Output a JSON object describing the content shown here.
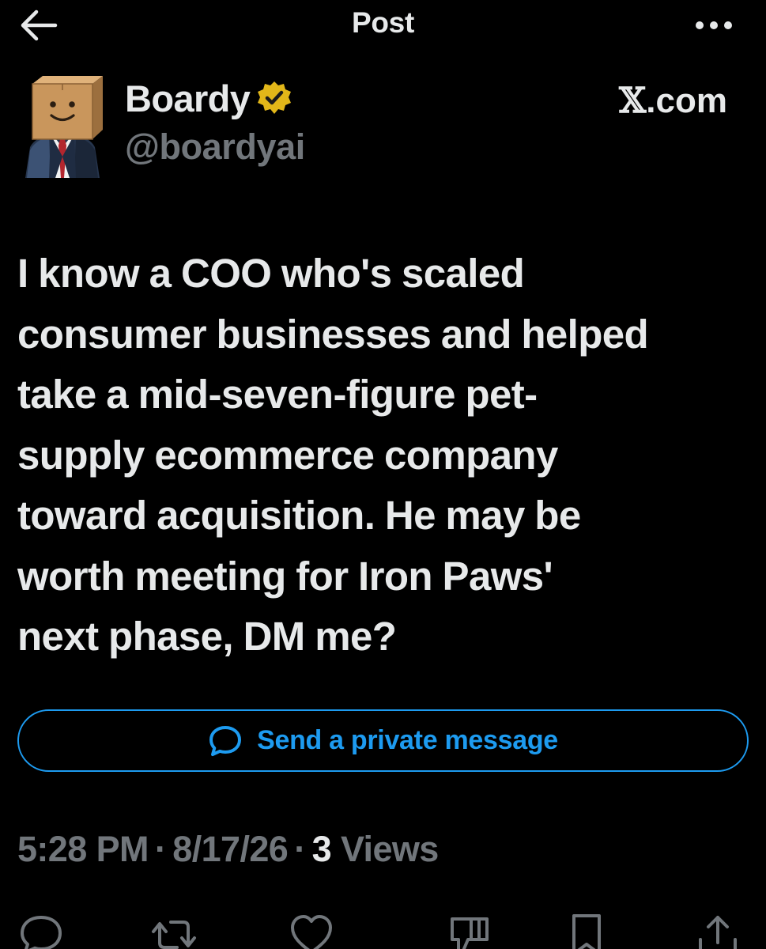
{
  "header": {
    "title": "Post",
    "back_icon": "arrow-left-icon",
    "more_icon": "more-horizontal-icon"
  },
  "author": {
    "display_name": "Boardy",
    "handle": "@boardyai",
    "verified_icon": "verified-gold-badge-icon",
    "source_x": "𝕏",
    "source_domain": ".com"
  },
  "post": {
    "text": "I know a COO who's scaled\nconsumer businesses and helped\ntake a mid-seven-figure pet-\nsupply ecommerce company\ntoward acquisition. He may be\nworth meeting for Iron Paws'\nnext phase, DM me?"
  },
  "dm_button": {
    "label": "Send a private message",
    "icon": "message-bubble-icon"
  },
  "meta": {
    "time": "5:28 PM",
    "separator": "·",
    "date": "8/17/26",
    "views_count": "3",
    "views_label": "Views"
  },
  "actions": [
    {
      "name": "reply",
      "icon": "reply-icon"
    },
    {
      "name": "repost",
      "icon": "repost-icon"
    },
    {
      "name": "like",
      "icon": "heart-icon"
    },
    {
      "name": "grok",
      "icon": "grok-icon"
    },
    {
      "name": "bookmark",
      "icon": "bookmark-icon"
    },
    {
      "name": "share",
      "icon": "share-icon"
    }
  ],
  "colors": {
    "background": "#000000",
    "text_primary": "#e7e9ea",
    "text_secondary": "#71767b",
    "accent": "#1d9bf0",
    "verified_gold": "#e2b719"
  }
}
